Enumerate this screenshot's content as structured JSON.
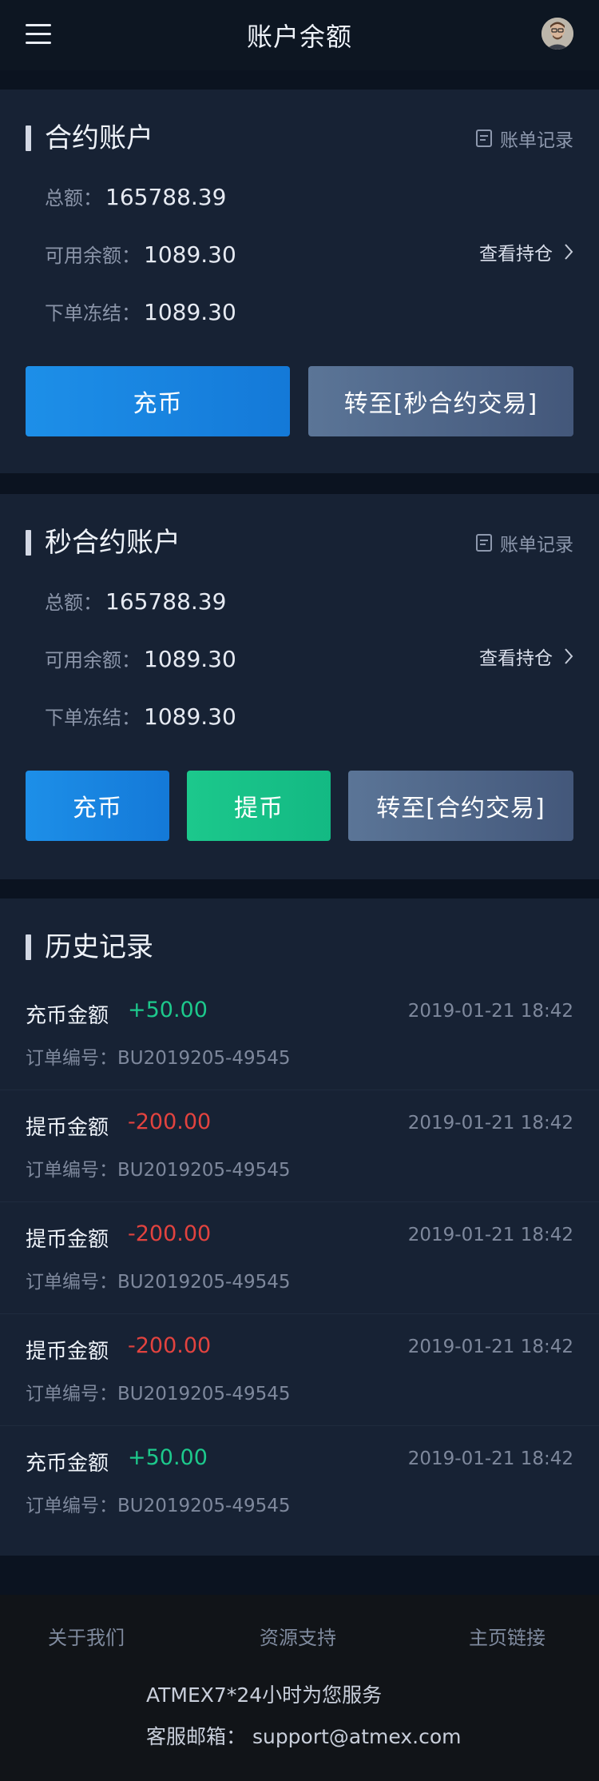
{
  "header": {
    "title": "账户余额"
  },
  "contract_account": {
    "title": "合约账户",
    "bill_label": "账单记录",
    "total_label": "总额：",
    "total_value": "165788.39",
    "available_label": "可用余额：",
    "available_value": "1089.30",
    "frozen_label": "下单冻结：",
    "frozen_value": "1089.30",
    "holdings_label": "查看持仓",
    "deposit_label": "充币",
    "transfer_label": "转至[秒合约交易]"
  },
  "second_contract_account": {
    "title": "秒合约账户",
    "bill_label": "账单记录",
    "total_label": "总额：",
    "total_value": "165788.39",
    "available_label": "可用余额：",
    "available_value": "1089.30",
    "frozen_label": "下单冻结：",
    "frozen_value": "1089.30",
    "holdings_label": "查看持仓",
    "deposit_label": "充币",
    "withdraw_label": "提币",
    "transfer_label": "转至[合约交易]"
  },
  "history": {
    "title": "历史记录",
    "order_label": "订单编号：",
    "items": [
      {
        "type": "充币金额",
        "amount": "+50.00",
        "time": "2019-01-21 18:42",
        "order": "BU2019205-49545",
        "direction": "pos"
      },
      {
        "type": "提币金额",
        "amount": "-200.00",
        "time": "2019-01-21 18:42",
        "order": "BU2019205-49545",
        "direction": "neg"
      },
      {
        "type": "提币金额",
        "amount": "-200.00",
        "time": "2019-01-21 18:42",
        "order": "BU2019205-49545",
        "direction": "neg"
      },
      {
        "type": "提币金额",
        "amount": "-200.00",
        "time": "2019-01-21 18:42",
        "order": "BU2019205-49545",
        "direction": "neg"
      },
      {
        "type": "充币金额",
        "amount": "+50.00",
        "time": "2019-01-21 18:42",
        "order": "BU2019205-49545",
        "direction": "pos"
      }
    ]
  },
  "footer": {
    "links": [
      "关于我们",
      "资源支持",
      "主页链接"
    ],
    "service_line": "ATMEX7*24小时为您服务",
    "email_line": "客服邮箱：  support@atmex.com"
  },
  "icons": {
    "menu": "menu-icon",
    "avatar": "user-avatar",
    "bill": "document-icon",
    "chevron": "chevron-right-icon"
  },
  "colors": {
    "positive": "#1dc98c",
    "negative": "#e2433f",
    "primary": "#1d8fe8",
    "success": "#1cc88c"
  }
}
